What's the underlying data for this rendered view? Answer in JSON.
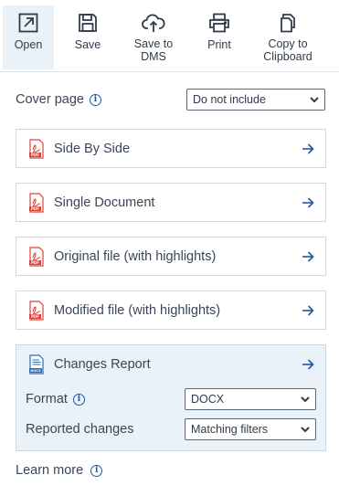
{
  "toolbar": {
    "open": {
      "label": "Open",
      "icon": "open-external-icon"
    },
    "save": {
      "label": "Save",
      "icon": "floppy-disk-icon"
    },
    "dms": {
      "label": "Save to DMS",
      "icon": "cloud-upload-icon"
    },
    "print": {
      "label": "Print",
      "icon": "printer-icon"
    },
    "copy": {
      "label": "Copy to Clipboard",
      "icon": "copy-icon"
    }
  },
  "cover": {
    "label": "Cover page",
    "selected": "Do not include",
    "options": [
      "Do not include"
    ]
  },
  "cards": [
    {
      "label": "Side By Side",
      "icon": "pdf-file-icon"
    },
    {
      "label": "Single Document",
      "icon": "pdf-file-icon"
    },
    {
      "label": "Original file (with highlights)",
      "icon": "pdf-file-icon"
    },
    {
      "label": "Modified file (with highlights)",
      "icon": "pdf-file-icon"
    }
  ],
  "report": {
    "label": "Changes Report",
    "icon": "docx-file-icon",
    "format_label": "Format",
    "format_selected": "DOCX",
    "format_options": [
      "DOCX"
    ],
    "changes_label": "Reported changes",
    "changes_selected": "Matching filters",
    "changes_options": [
      "Matching filters"
    ]
  },
  "learn_more": "Learn more",
  "colors": {
    "accent": "#1e5aa0",
    "pdf_red": "#d9433a",
    "active_bg": "#eaf2f9",
    "text": "#3a4657"
  }
}
